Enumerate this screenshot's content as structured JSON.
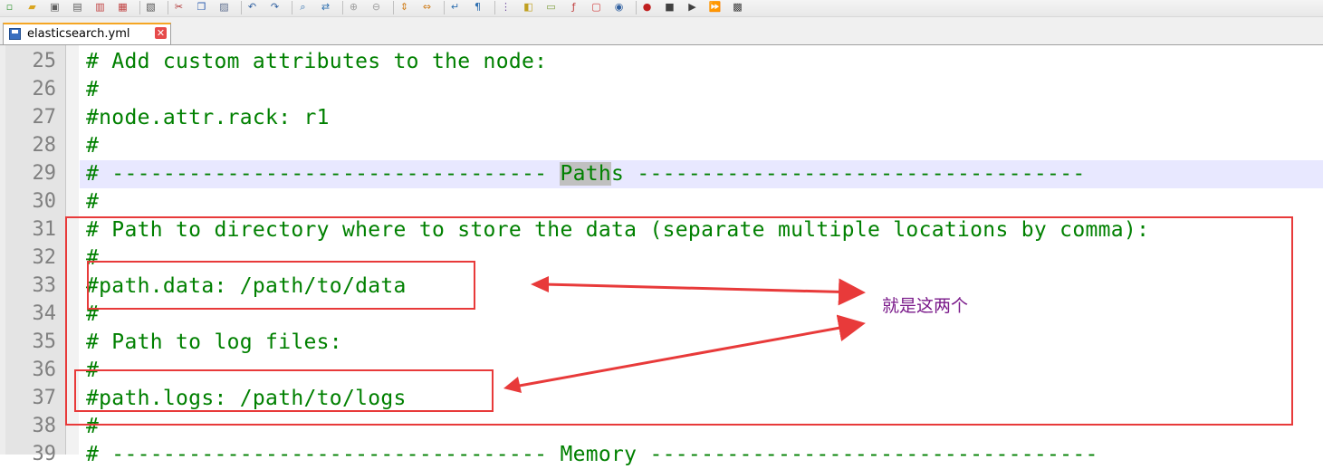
{
  "tab": {
    "filename": "elasticsearch.yml",
    "close_glyph": "✕"
  },
  "editor": {
    "lines": [
      {
        "n": "25",
        "text": "# Add custom attributes to the node:"
      },
      {
        "n": "26",
        "text": "#"
      },
      {
        "n": "27",
        "text": "#node.attr.rack: r1"
      },
      {
        "n": "28",
        "text": "#"
      },
      {
        "n": "29",
        "pre": "# ---------------------------------- ",
        "word": "Path",
        "post": "s -----------------------------------",
        "current": true
      },
      {
        "n": "30",
        "text": "#"
      },
      {
        "n": "31",
        "text": "# Path to directory where to store the data (separate multiple locations by comma):"
      },
      {
        "n": "32",
        "text": "#"
      },
      {
        "n": "33",
        "text": "#path.data: /path/to/data"
      },
      {
        "n": "34",
        "text": "#"
      },
      {
        "n": "35",
        "text": "# Path to log files:"
      },
      {
        "n": "36",
        "text": "#"
      },
      {
        "n": "37",
        "text": "#path.logs: /path/to/logs"
      },
      {
        "n": "38",
        "text": "#"
      },
      {
        "n": "39",
        "text": "# ---------------------------------- Memory -----------------------------------"
      }
    ]
  },
  "annotation": {
    "note": "就是这两个",
    "color": "#e83a3a"
  },
  "toolbar_icons": [
    "new-file-icon",
    "open-file-icon",
    "save-icon",
    "save-all-icon",
    "close-icon",
    "close-all-icon",
    "print-icon",
    "cut-icon",
    "copy-icon",
    "paste-icon",
    "undo-icon",
    "redo-icon",
    "find-icon",
    "replace-icon",
    "zoom-in-icon",
    "zoom-out-icon",
    "sync-vertical-icon",
    "sync-horizontal-icon",
    "word-wrap-icon",
    "show-all-chars-icon",
    "indent-guide-icon",
    "lang-icon",
    "doc-map-icon",
    "function-list-icon",
    "folder-workspace-icon",
    "monitor-icon",
    "record-macro-icon",
    "stop-macro-icon",
    "play-macro-icon",
    "run-macro-multiple-icon",
    "save-macro-icon"
  ]
}
